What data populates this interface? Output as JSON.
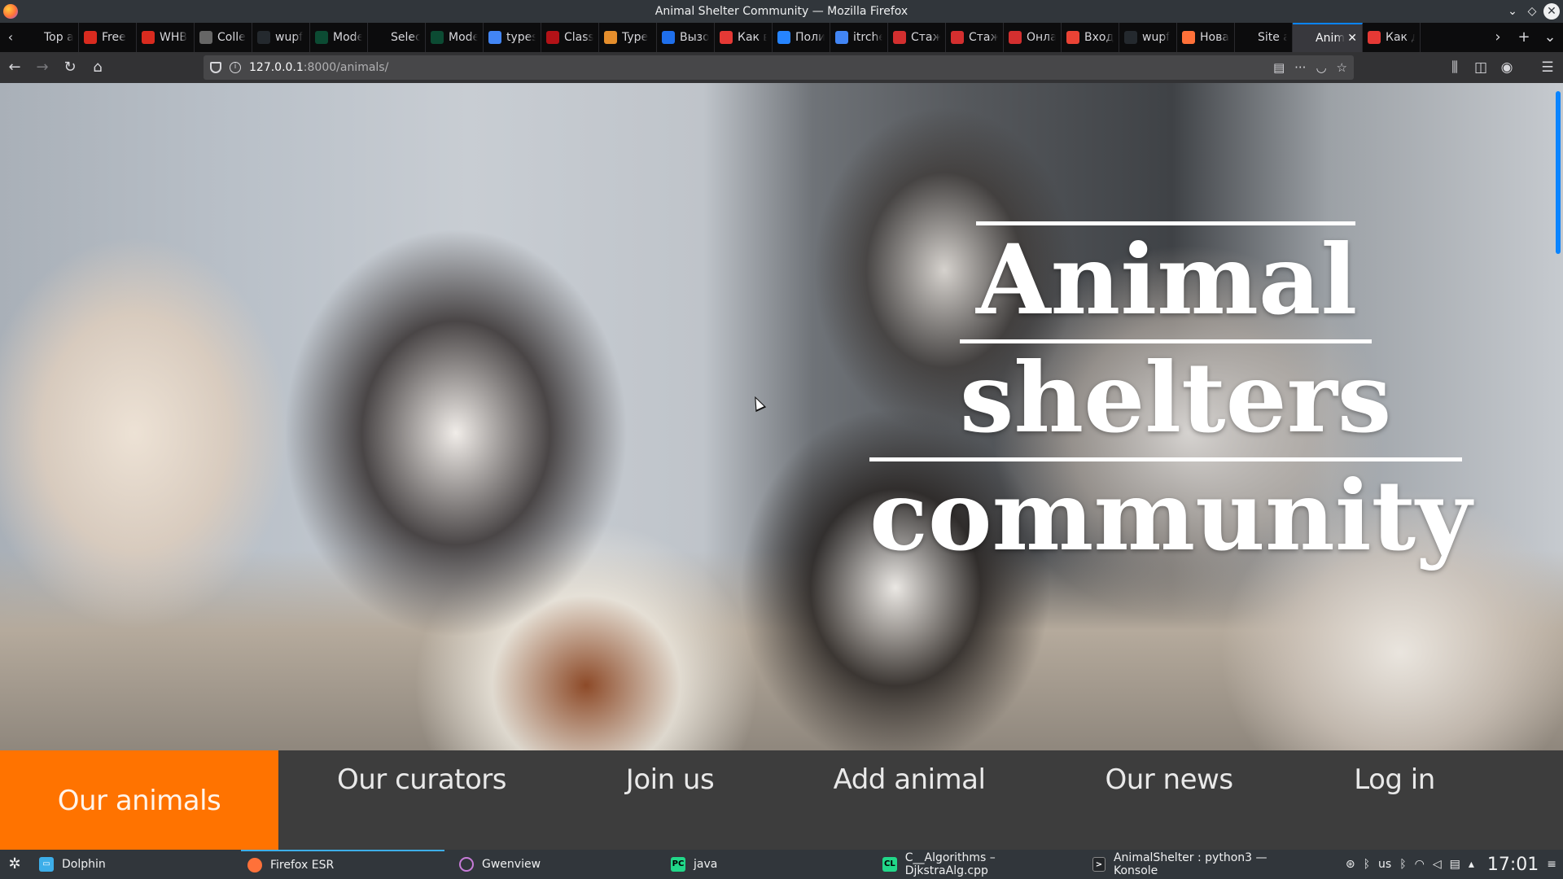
{
  "window": {
    "title": "Animal Shelter Community — Mozilla Firefox"
  },
  "tabs": [
    {
      "label": "Top a",
      "icon": "blank-icon",
      "color": "#0c0c0d"
    },
    {
      "label": "Free",
      "icon": "freecodecamp-icon",
      "color": "#d92b1f"
    },
    {
      "label": "WHB",
      "icon": "freecodecamp-icon",
      "color": "#d92b1f"
    },
    {
      "label": "Colle",
      "icon": "dash-icon",
      "color": "#666666"
    },
    {
      "label": "wupf",
      "icon": "github-icon",
      "color": "#24292e"
    },
    {
      "label": "Mode",
      "icon": "django-icon",
      "color": "#0c4b33"
    },
    {
      "label": "Select ar",
      "icon": "blank-icon",
      "color": "#0c0c0d"
    },
    {
      "label": "Mode",
      "icon": "django-icon",
      "color": "#0c4b33"
    },
    {
      "label": "types",
      "icon": "google-icon",
      "color": "#4285f4"
    },
    {
      "label": "Class",
      "icon": "codecademy-icon",
      "color": "#b31217"
    },
    {
      "label": "Type",
      "icon": "ts-icon",
      "color": "#e58e2c"
    },
    {
      "label": "Вызо",
      "icon": "stack-icon",
      "color": "#1f6feb"
    },
    {
      "label": "Как в",
      "icon": "code-icon",
      "color": "#e53935"
    },
    {
      "label": "Поли",
      "icon": "jira-icon",
      "color": "#2684ff"
    },
    {
      "label": "itrche",
      "icon": "google-icon",
      "color": "#4285f4"
    },
    {
      "label": "Стаж",
      "icon": "flag-icon",
      "color": "#d32f2f"
    },
    {
      "label": "Стаж",
      "icon": "flag-icon",
      "color": "#d32f2f"
    },
    {
      "label": "Онла",
      "icon": "flag-icon",
      "color": "#d32f2f"
    },
    {
      "label": "Вход",
      "icon": "gmail-icon",
      "color": "#ea4335"
    },
    {
      "label": "wupf",
      "icon": "github-icon",
      "color": "#24292e"
    },
    {
      "label": "Нова",
      "icon": "firefox-icon",
      "color": "#ff7139"
    },
    {
      "label": "Site adm",
      "icon": "blank-icon",
      "color": "#0c0c0d"
    },
    {
      "label": "Anim",
      "icon": "blank-icon",
      "color": "#38383d",
      "active": true
    },
    {
      "label": "Как д",
      "icon": "os-icon",
      "color": "#e53935"
    }
  ],
  "navbar": {
    "url_host": "127.0.0.1",
    "url_rest": ":8000/animals/"
  },
  "hero": {
    "title_line1": "Animal",
    "title_line2": "shelters",
    "title_line3": "community"
  },
  "site_nav": {
    "items": [
      {
        "label": "Our animals",
        "active": true
      },
      {
        "label": "Our curators"
      },
      {
        "label": "Join us"
      },
      {
        "label": "Add animal"
      },
      {
        "label": "Our news"
      },
      {
        "label": "Log in"
      }
    ],
    "accent_color": "#ff7300",
    "background_color": "#3d3d3d"
  },
  "taskbar": {
    "tasks": [
      {
        "label": "Dolphin",
        "icon": "dolphin-icon"
      },
      {
        "label": "Firefox ESR",
        "icon": "firefox-icon",
        "active": true
      },
      {
        "label": "Gwenview",
        "icon": "gwenview-icon"
      },
      {
        "label": "java",
        "icon": "pycharm-icon"
      },
      {
        "label": "C__Algorithms – DjkstraAlg.cpp",
        "icon": "clion-icon"
      },
      {
        "label": "AnimalShelter : python3 — Konsole",
        "icon": "konsole-icon"
      }
    ],
    "keyboard_layout": "us",
    "clock": "17:01"
  }
}
